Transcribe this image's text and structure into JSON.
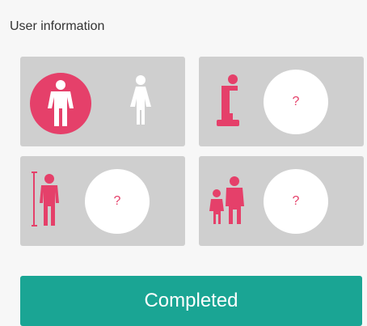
{
  "header": {
    "title": "User information"
  },
  "cards": {
    "gender": {
      "selected": "male",
      "icons": [
        "male-icon",
        "female-icon"
      ],
      "accent_color": "#e5406a"
    },
    "weight": {
      "icon": "weight-scale-icon",
      "value": "?"
    },
    "height": {
      "icon": "height-icon",
      "value": "?"
    },
    "age": {
      "icon": "age-icon",
      "value": "?"
    }
  },
  "actions": {
    "complete_label": "Completed",
    "button_color": "#1aa594"
  }
}
